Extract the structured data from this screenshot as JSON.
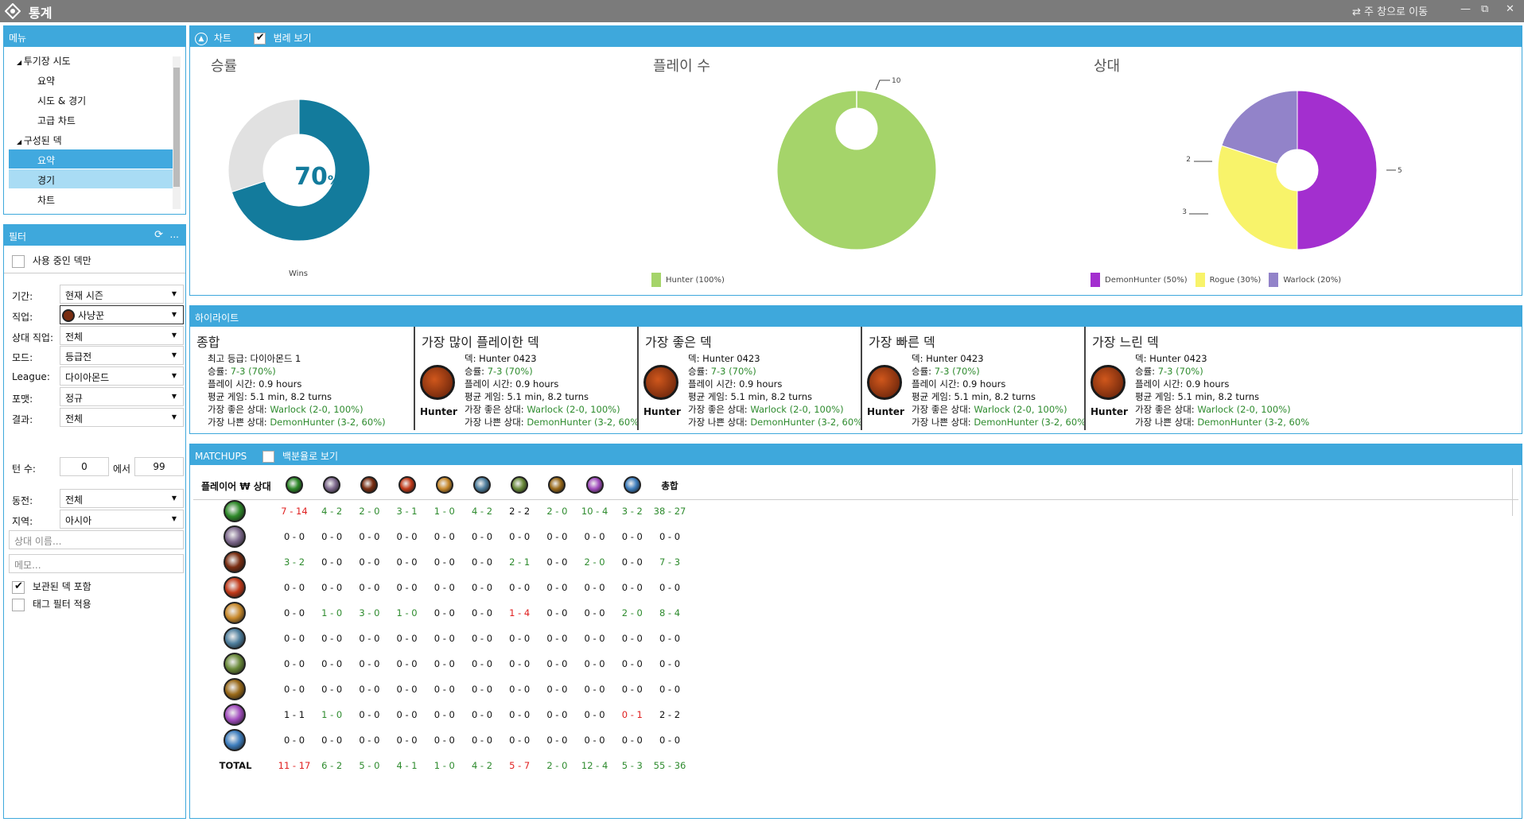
{
  "window": {
    "title": "통계",
    "goto_main": "주 창으로 이동",
    "minimize": "—",
    "restore": "⧉",
    "close": "✕"
  },
  "menu": {
    "header": "메뉴",
    "items": [
      {
        "label": "투기장 시도",
        "group": true
      },
      {
        "label": "요약"
      },
      {
        "label": "시도 & 경기"
      },
      {
        "label": "고급 차트"
      },
      {
        "label": "구성된 덱",
        "group": true
      },
      {
        "label": "요약",
        "selected": true
      },
      {
        "label": "경기",
        "hover": true
      },
      {
        "label": "차트"
      }
    ]
  },
  "filter": {
    "header": "필터",
    "refresh_icon": "refresh-icon",
    "more": "...",
    "in_use_only": "사용 중인 덱만",
    "rows": [
      {
        "label": "기간:",
        "value": "현재 시즌"
      },
      {
        "label": "직업:",
        "value": "사냥꾼"
      },
      {
        "label": "상대 직업:",
        "value": "전체"
      },
      {
        "label": "모드:",
        "value": "등급전"
      },
      {
        "label": "League:",
        "value": "다이아몬드"
      },
      {
        "label": "포맷:",
        "value": "정규"
      },
      {
        "label": "결과:",
        "value": "전체"
      }
    ],
    "turns_label": "턴 수:",
    "turns_from": "0",
    "turns_between": "에서",
    "turns_to": "99",
    "rows2": [
      {
        "label": "동전:",
        "value": "전체"
      },
      {
        "label": "지역:",
        "value": "아시아"
      }
    ],
    "opponent_placeholder": "상대 이름...",
    "note_placeholder": "메모...",
    "include_archived": "보관된 덱 포함",
    "tag_filter": "태그 필터 적용"
  },
  "charts": {
    "header_label": "차트",
    "legend_toggle": "범례 보기",
    "winrate": {
      "title": "승률",
      "center": "70",
      "unit": "%",
      "label": "Wins"
    },
    "plays": {
      "title": "플레이 수",
      "callout": "10"
    },
    "opponent": {
      "title": "상대",
      "callouts": [
        "2",
        "3",
        "5"
      ]
    }
  },
  "chart_data": [
    {
      "type": "pie",
      "title": "승률",
      "series": [
        {
          "name": "Wins",
          "values": [
            70,
            30
          ]
        }
      ],
      "labels": [
        "Wins",
        ""
      ]
    },
    {
      "type": "pie",
      "title": "플레이 수",
      "labels": [
        "Hunter (100%)"
      ],
      "values": [
        10
      ]
    },
    {
      "type": "pie",
      "title": "상대",
      "labels": [
        "DemonHunter (50%)",
        "Rogue (30%)",
        "Warlock (20%)"
      ],
      "values": [
        5,
        3,
        2
      ]
    }
  ],
  "colors": {
    "accent": "#3ea8dc",
    "win": "#137b9c",
    "loss": "#e1e1e1",
    "hunter": "#a5d46a",
    "demonhunter": "#a32fcf",
    "rogue": "#f8f36a",
    "warlock": "#9283c9"
  },
  "highlights": {
    "header": "하이라이트",
    "cards": [
      {
        "title": "종합",
        "lines": [
          {
            "k": "최고 등급: 다이아몬드 1",
            "v": ""
          },
          {
            "k": "승률: ",
            "v": "7-3 (70%)"
          },
          {
            "k": "플레이 시간: 0.9 hours",
            "v": ""
          },
          {
            "k": "평균 게임: 5.1 min, 8.2 turns",
            "v": ""
          },
          {
            "k": "가장 좋은 상대: ",
            "v": "Warlock (2-0, 100%)"
          },
          {
            "k": "가장 나쁜 상대: ",
            "v": "DemonHunter (3-2, 60%)"
          }
        ]
      },
      {
        "title": "가장 많이 플레이한 덱",
        "cls": "Hunter",
        "lines": [
          {
            "k": "덱: Hunter 0423",
            "v": ""
          },
          {
            "k": "승률: ",
            "v": "7-3 (70%)"
          },
          {
            "k": "플레이 시간: 0.9 hours",
            "v": ""
          },
          {
            "k": "평균 게임: 5.1 min, 8.2 turns",
            "v": ""
          },
          {
            "k": "가장 좋은 상대: ",
            "v": "Warlock (2-0, 100%)"
          },
          {
            "k": "가장 나쁜 상대: ",
            "v": "DemonHunter (3-2, 60%"
          }
        ]
      },
      {
        "title": "가장 좋은 덱",
        "cls": "Hunter",
        "lines": [
          {
            "k": "덱: Hunter 0423",
            "v": ""
          },
          {
            "k": "승률: ",
            "v": "7-3 (70%)"
          },
          {
            "k": "플레이 시간: 0.9 hours",
            "v": ""
          },
          {
            "k": "평균 게임: 5.1 min, 8.2 turns",
            "v": ""
          },
          {
            "k": "가장 좋은 상대: ",
            "v": "Warlock (2-0, 100%)"
          },
          {
            "k": "가장 나쁜 상대: ",
            "v": "DemonHunter (3-2, 60%"
          }
        ]
      },
      {
        "title": "가장 빠른 덱",
        "cls": "Hunter",
        "lines": [
          {
            "k": "덱: Hunter 0423",
            "v": ""
          },
          {
            "k": "승률: ",
            "v": "7-3 (70%)"
          },
          {
            "k": "플레이 시간: 0.9 hours",
            "v": ""
          },
          {
            "k": "평균 게임: 5.1 min, 8.2 turns",
            "v": ""
          },
          {
            "k": "가장 좋은 상대: ",
            "v": "Warlock (2-0, 100%)"
          },
          {
            "k": "가장 나쁜 상대: ",
            "v": "DemonHunter (3-2, 60%"
          }
        ]
      },
      {
        "title": "가장 느린 덱",
        "cls": "Hunter",
        "lines": [
          {
            "k": "덱: Hunter 0423",
            "v": ""
          },
          {
            "k": "승률: ",
            "v": "7-3 (70%)"
          },
          {
            "k": "플레이 시간: 0.9 hours",
            "v": ""
          },
          {
            "k": "평균 게임: 5.1 min, 8.2 turns",
            "v": ""
          },
          {
            "k": "가장 좋은 상대: ",
            "v": "Warlock (2-0, 100%)"
          },
          {
            "k": "가장 나쁜 상대: ",
            "v": "DemonHunter (3-2, 60%"
          }
        ]
      }
    ]
  },
  "matchups": {
    "header": "MATCHUPS",
    "percent_toggle": "백분율로 보기",
    "corner": "플레이어 ₩ 상대",
    "total_col": "총합",
    "total_row": "TOTAL",
    "class_icons": [
      {
        "name": "druid-icon",
        "color": "#2f8a2a"
      },
      {
        "name": "warlock-icon",
        "color": "#7f6a8e"
      },
      {
        "name": "hunter-icon",
        "color": "#7a2e12"
      },
      {
        "name": "mage-icon",
        "color": "#c23a1a"
      },
      {
        "name": "paladin-icon",
        "color": "#c98a2c"
      },
      {
        "name": "priest-icon",
        "color": "#4f7f9e"
      },
      {
        "name": "shaman-icon",
        "color": "#6a8a3a"
      },
      {
        "name": "rogue-icon",
        "color": "#9a6a1a"
      },
      {
        "name": "demonhunter-icon",
        "color": "#a44fc0"
      },
      {
        "name": "warrior-icon",
        "color": "#3f7fbf"
      }
    ],
    "rows": [
      [
        "7 - 14",
        "4 - 2",
        "2 - 0",
        "3 - 1",
        "1 - 0",
        "4 - 2",
        "2 - 2",
        "2 - 0",
        "10 - 4",
        "3 - 2",
        "38 - 27"
      ],
      [
        "0 - 0",
        "0 - 0",
        "0 - 0",
        "0 - 0",
        "0 - 0",
        "0 - 0",
        "0 - 0",
        "0 - 0",
        "0 - 0",
        "0 - 0",
        "0 - 0"
      ],
      [
        "3 - 2",
        "0 - 0",
        "0 - 0",
        "0 - 0",
        "0 - 0",
        "0 - 0",
        "2 - 1",
        "0 - 0",
        "2 - 0",
        "0 - 0",
        "7 - 3"
      ],
      [
        "0 - 0",
        "0 - 0",
        "0 - 0",
        "0 - 0",
        "0 - 0",
        "0 - 0",
        "0 - 0",
        "0 - 0",
        "0 - 0",
        "0 - 0",
        "0 - 0"
      ],
      [
        "0 - 0",
        "1 - 0",
        "3 - 0",
        "1 - 0",
        "0 - 0",
        "0 - 0",
        "1 - 4",
        "0 - 0",
        "0 - 0",
        "2 - 0",
        "8 - 4"
      ],
      [
        "0 - 0",
        "0 - 0",
        "0 - 0",
        "0 - 0",
        "0 - 0",
        "0 - 0",
        "0 - 0",
        "0 - 0",
        "0 - 0",
        "0 - 0",
        "0 - 0"
      ],
      [
        "0 - 0",
        "0 - 0",
        "0 - 0",
        "0 - 0",
        "0 - 0",
        "0 - 0",
        "0 - 0",
        "0 - 0",
        "0 - 0",
        "0 - 0",
        "0 - 0"
      ],
      [
        "0 - 0",
        "0 - 0",
        "0 - 0",
        "0 - 0",
        "0 - 0",
        "0 - 0",
        "0 - 0",
        "0 - 0",
        "0 - 0",
        "0 - 0",
        "0 - 0"
      ],
      [
        "1 - 1",
        "1 - 0",
        "0 - 0",
        "0 - 0",
        "0 - 0",
        "0 - 0",
        "0 - 0",
        "0 - 0",
        "0 - 0",
        "0 - 1",
        "2 - 2"
      ],
      [
        "0 - 0",
        "0 - 0",
        "0 - 0",
        "0 - 0",
        "0 - 0",
        "0 - 0",
        "0 - 0",
        "0 - 0",
        "0 - 0",
        "0 - 0",
        "0 - 0"
      ]
    ],
    "totals": [
      "11 - 17",
      "6 - 2",
      "5 - 0",
      "4 - 1",
      "1 - 0",
      "4 - 2",
      "5 - 7",
      "2 - 0",
      "12 - 4",
      "5 - 3",
      "55 - 36"
    ]
  }
}
